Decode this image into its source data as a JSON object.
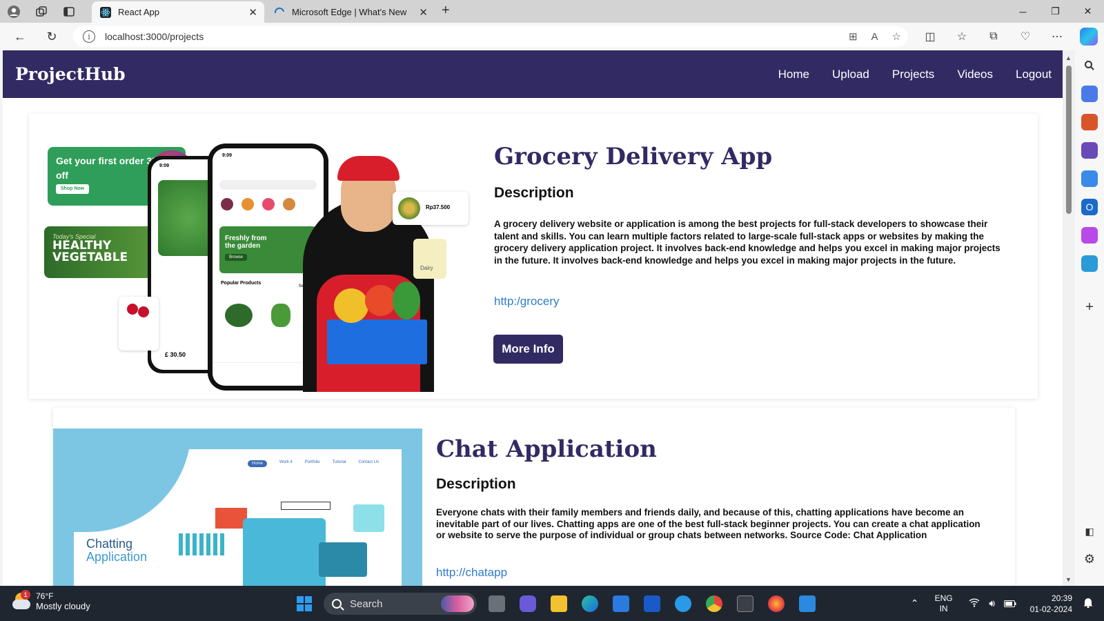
{
  "browser": {
    "tabs": [
      {
        "title": "React App",
        "active": true
      },
      {
        "title": "Microsoft Edge | What's New",
        "active": false
      }
    ],
    "url": "localhost:3000/projects"
  },
  "site": {
    "brand": "ProjectHub",
    "nav": [
      "Home",
      "Upload",
      "Projects",
      "Videos",
      "Logout"
    ]
  },
  "projects": [
    {
      "title": "Grocery Delivery App",
      "desc_heading": "Description",
      "description": "A grocery delivery website or application is among the best projects for full-stack developers to showcase their talent and skills. You can learn multiple factors related to large-scale full-stack apps or websites by making the grocery delivery application project. It involves back-end knowledge and helps you excel in making major projects in the future. It involves back-end knowledge and helps you excel in making major projects in the future.",
      "link": "http:/grocery",
      "button": "More Info",
      "image_text": {
        "promo1": "Get your first order 35% off",
        "promo1_btn": "Shop Now",
        "promo2a": "Today's Special",
        "promo2b": "HEALTHY VEGETABLE",
        "banner": "Freshly from the garden",
        "banner_btn": "Browse",
        "popular": "Popular Products",
        "see_all": "See all",
        "price1": "Rp37.500",
        "dairy": "Dairy",
        "product_price": "£ 30.50",
        "time": "9:09"
      }
    },
    {
      "title": "Chat Application",
      "desc_heading": "Description",
      "description": "Everyone chats with their family members and friends daily, and because of this, chatting applications have become an inevitable part of our lives. Chatting apps are one of the best full-stack beginner projects. You can create a chat application or website to serve the purpose of individual or group chats between networks. Source Code: Chat Application",
      "link": "http://chatapp",
      "image_text": {
        "heading_line1": "Chatting",
        "heading_line2": "Application",
        "nav": [
          "Home",
          "Work it",
          "Portfolio",
          "Tutorial",
          "Contact Us"
        ]
      }
    }
  ],
  "taskbar": {
    "temp": "76°F",
    "condition": "Mostly cloudy",
    "weather_badge": "1",
    "search": "Search",
    "lang1": "ENG",
    "lang2": "IN",
    "time": "20:39",
    "date": "01-02-2024"
  }
}
